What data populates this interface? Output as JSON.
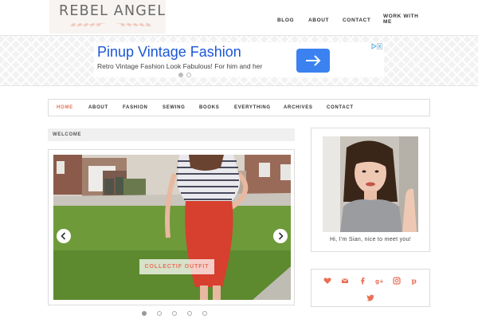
{
  "header": {
    "logo_text": "REBEL ANGEL",
    "nav": [
      "BLOG",
      "ABOUT",
      "CONTACT",
      "WORK WITH",
      "ME"
    ]
  },
  "ad": {
    "title": "Pinup Vintage Fashion",
    "description": "Retro Vintage Fashion Look Fabulous! For him and her",
    "cta_icon": "arrow-right-icon",
    "choices_icon": "adchoices-icon"
  },
  "main_nav": {
    "items": [
      "HOME",
      "ABOUT",
      "FASHION",
      "SEWING",
      "BOOKS",
      "EVERYTHING",
      "ARCHIVES",
      "CONTACT"
    ],
    "active": "HOME"
  },
  "welcome": {
    "heading": "WELCOME",
    "slide_caption": "COLLECTIF OUTFIT",
    "slide_count": 5,
    "active_slide": 1
  },
  "sidebar": {
    "profile_caption": "Hi, I'm Sian, nice to meet you!",
    "social_icons": [
      "heart-icon",
      "email-icon",
      "facebook-icon",
      "google-plus-icon",
      "instagram-icon",
      "pinterest-icon",
      "twitter-icon"
    ]
  },
  "colors": {
    "accent": "#e96f55",
    "ad_blue": "#1a57d6",
    "ad_button": "#3b82f0",
    "border": "#dcdcdc"
  }
}
